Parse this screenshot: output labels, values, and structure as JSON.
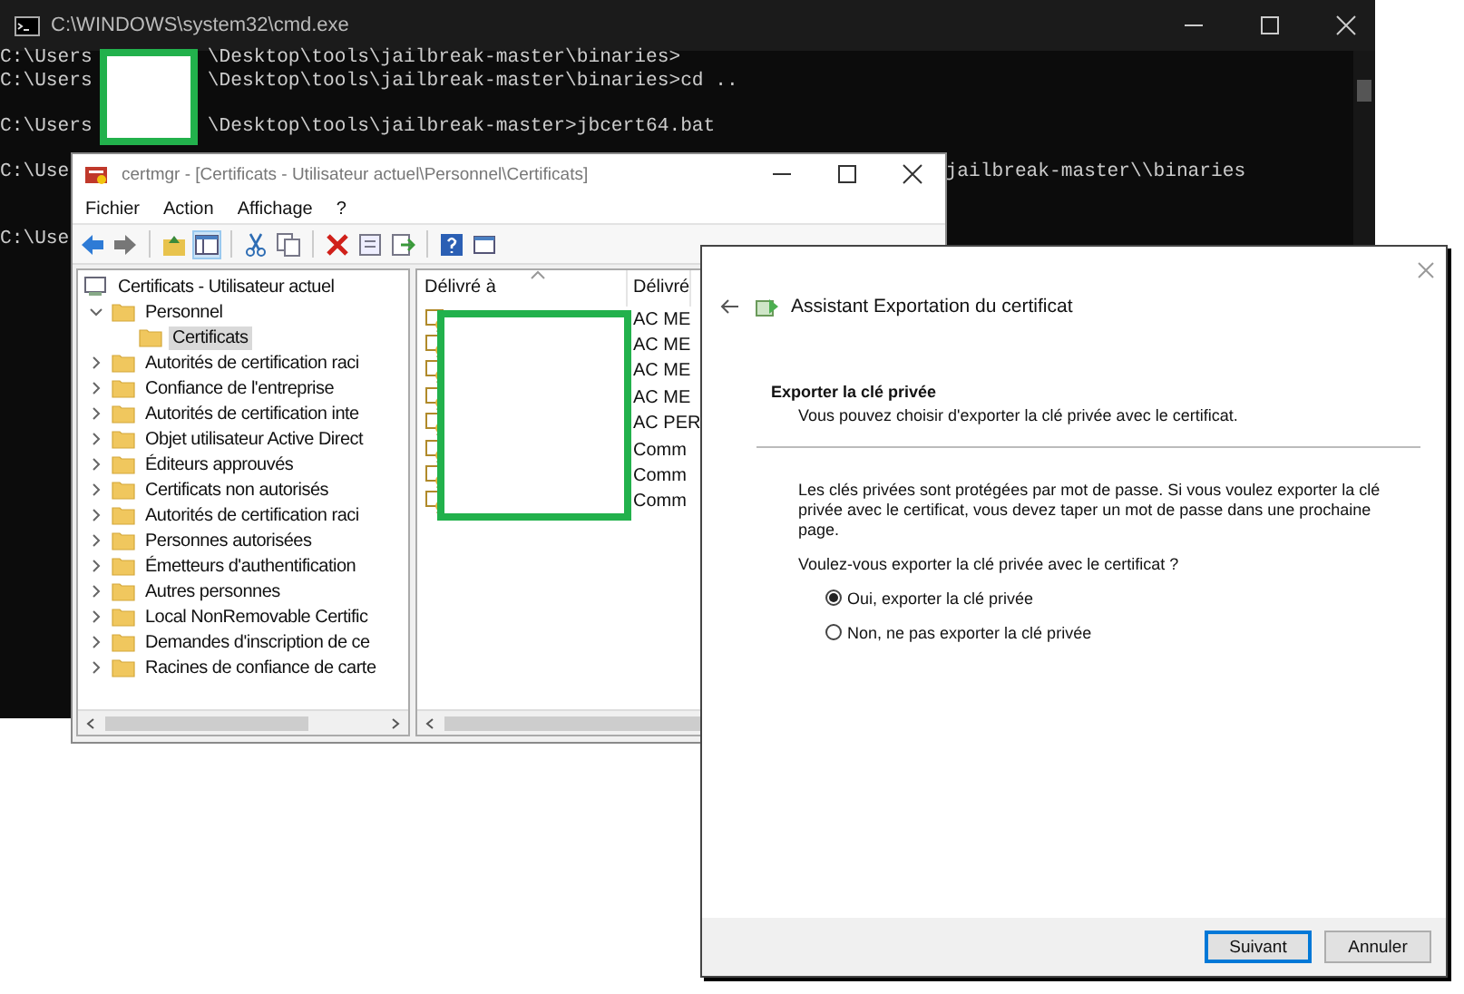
{
  "console_window": {
    "title": "C:\\WINDOWS\\system32\\cmd.exe",
    "lines": [
      {
        "kind": "redacted",
        "parts": [
          "C:\\Users",
          "\\Desktop\\tools\\jailbreak-master\\binaries>"
        ]
      },
      {
        "kind": "redacted",
        "parts": [
          "C:\\Users",
          "\\Desktop\\tools\\jailbreak-master\\binaries>cd .."
        ]
      },
      {
        "kind": "blank"
      },
      {
        "kind": "redacted",
        "parts": [
          "C:\\Users",
          "\\Desktop\\tools\\jailbreak-master>jbcert64.bat"
        ]
      },
      {
        "kind": "blank"
      },
      {
        "kind": "covered",
        "parts": [
          "C:\\Use",
          "jailbreak-master\\\\binaries"
        ]
      },
      {
        "kind": "blank"
      },
      {
        "kind": "blank"
      },
      {
        "kind": "plain",
        "parts": [
          "C:\\Use"
        ]
      }
    ]
  },
  "certmgr_window": {
    "title": "certmgr - [Certificats - Utilisateur actuel\\Personnel\\Certificats]",
    "menu": [
      "Fichier",
      "Action",
      "Affichage",
      "?"
    ],
    "tree": [
      {
        "label": "Certificats - Utilisateur actuel",
        "selected": false,
        "children": [
          {
            "label": "Personnel",
            "expanded": true,
            "selected": false,
            "children": [
              {
                "label": "Certificats",
                "selected": true
              }
            ]
          },
          {
            "label": "Autorités de certification raci",
            "expanded": false,
            "selected": false
          },
          {
            "label": "Confiance de l'entreprise",
            "expanded": false,
            "selected": false
          },
          {
            "label": "Autorités de certification inte",
            "expanded": false,
            "selected": false
          },
          {
            "label": "Objet utilisateur Active Direct",
            "expanded": false,
            "selected": false
          },
          {
            "label": "Éditeurs approuvés",
            "expanded": false,
            "selected": false
          },
          {
            "label": "Certificats non autorisés",
            "expanded": false,
            "selected": false
          },
          {
            "label": "Autorités de certification raci",
            "expanded": false,
            "selected": false
          },
          {
            "label": "Personnes autorisées",
            "expanded": false,
            "selected": false
          },
          {
            "label": "Émetteurs d'authentification",
            "expanded": false,
            "selected": false
          },
          {
            "label": "Autres personnes",
            "expanded": false,
            "selected": false
          },
          {
            "label": "Local NonRemovable Certific",
            "expanded": false,
            "selected": false
          },
          {
            "label": "Demandes d'inscription de ce",
            "expanded": false,
            "selected": false
          },
          {
            "label": "Racines de confiance de carte",
            "expanded": false,
            "selected": false
          }
        ]
      }
    ],
    "table": {
      "columns": [
        "Délivré à",
        "Délivré"
      ],
      "rows": [
        {
          "column_2": "AC ME"
        },
        {
          "column_2": "AC ME"
        },
        {
          "column_2": "AC ME"
        },
        {
          "column_2": "AC ME"
        },
        {
          "column_2": "AC PER"
        },
        {
          "column_2": "Comm"
        },
        {
          "column_2": "Comm"
        },
        {
          "column_2": "Comm"
        }
      ]
    }
  },
  "wizard": {
    "title": "Assistant Exportation du certificat",
    "section_title": "Exporter la clé privée",
    "section_subtitle": "Vous pouvez choisir d'exporter la clé privée avec le certificat.",
    "paragraph": "Les clés privées sont protégées par mot de passe. Si vous voulez exporter la clé privée avec le certificat, vous devez taper un mot de passe dans une prochaine page.",
    "question": "Voulez-vous exporter la clé privée avec le certificat ?",
    "options": [
      {
        "label": "Oui, exporter la clé privée",
        "selected": true
      },
      {
        "label": "Non, ne pas exporter la clé privée",
        "selected": false
      }
    ],
    "buttons": [
      {
        "label": "Suivant",
        "kind": "default"
      },
      {
        "label": "Annuler",
        "kind": "normal"
      }
    ]
  }
}
